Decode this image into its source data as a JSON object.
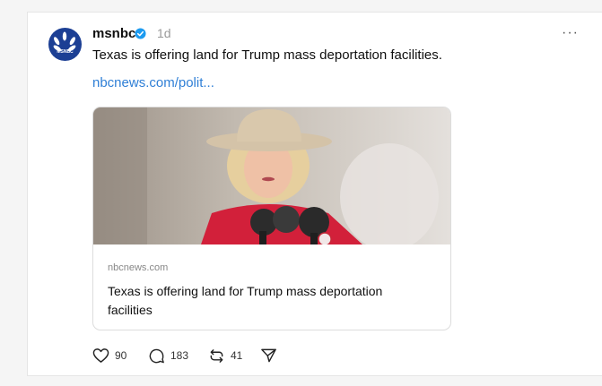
{
  "post": {
    "username": "msnbc",
    "time": "1d",
    "more_label": "···",
    "text": "Texas is offering land for Trump mass deportation facilities.",
    "link_text": "nbcnews.com/polit...",
    "avatar_label": "MSNBC",
    "card": {
      "domain": "nbcnews.com",
      "title": "Texas is offering land for Trump mass deportation facilities"
    },
    "actions": {
      "likes": "90",
      "replies": "183",
      "reposts": "41"
    }
  },
  "colors": {
    "link": "#2f7fd6",
    "verified": "#1d9bf0",
    "avatar_bg": "#1c3f94"
  },
  "icons": [
    "heart-icon",
    "reply-icon",
    "repost-icon",
    "share-icon",
    "verified-icon",
    "more-icon"
  ]
}
